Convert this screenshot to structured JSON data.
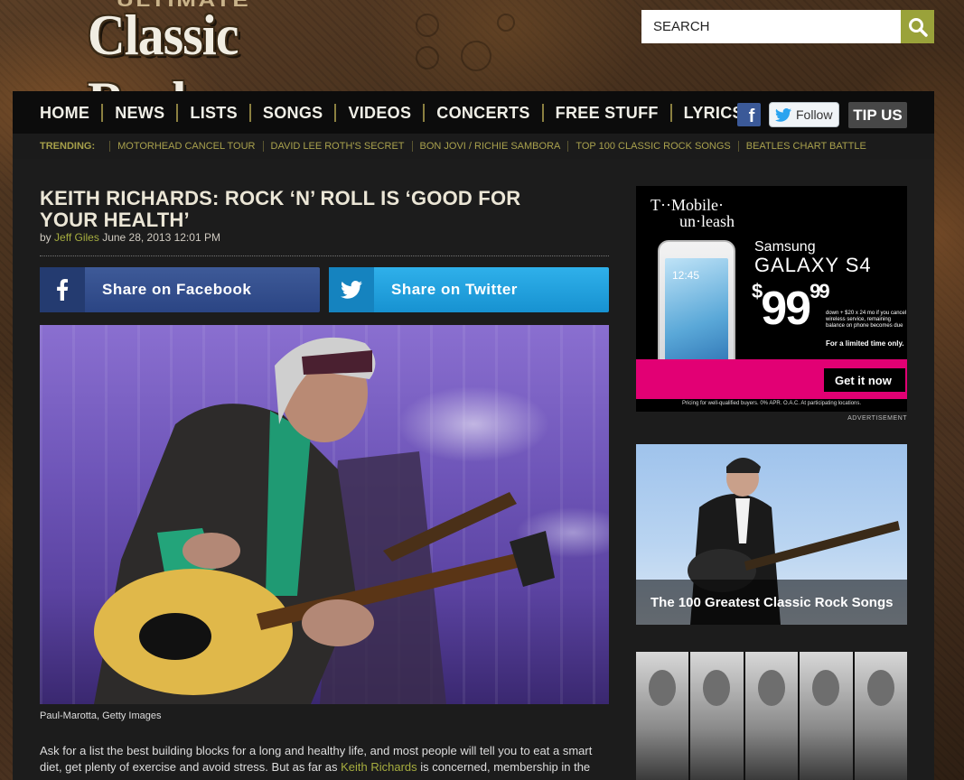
{
  "header": {
    "logo_top": "ULTIMATE",
    "logo_main": "Classic Rock",
    "search_placeholder": "SEARCH"
  },
  "nav": {
    "items": [
      "HOME",
      "NEWS",
      "LISTS",
      "SONGS",
      "VIDEOS",
      "CONCERTS",
      "FREE STUFF",
      "LYRICS"
    ],
    "follow_label": "Follow",
    "tip_label": "TIP US"
  },
  "trending": {
    "label": "TRENDING:",
    "items": [
      "MOTORHEAD CANCEL TOUR",
      "DAVID LEE ROTH'S SECRET",
      "BON JOVI / RICHIE SAMBORA",
      "TOP 100 CLASSIC ROCK SONGS",
      "BEATLES CHART BATTLE"
    ]
  },
  "article": {
    "title": "KEITH RICHARDS: ROCK ‘N’ ROLL IS ‘GOOD FOR YOUR HEALTH’",
    "by": "by",
    "author": "Jeff Giles",
    "date": "June 28, 2013 12:01 PM",
    "share_facebook": "Share on Facebook",
    "share_twitter": "Share on Twitter",
    "photo_credit": "Paul-Marotta, Getty Images",
    "para_1": "Ask for a list the best building blocks for a long and healthy life, and most people will tell you to eat a smart diet, get plenty of exercise and avoid stress. But as far as ",
    "para_link": "Keith Richards",
    "para_2": " is concerned, membership in the"
  },
  "ad": {
    "brand_line1": "T··Mobile·",
    "brand_line2": "un·leash",
    "screen_time": "12:45",
    "model_line1": "Samsung",
    "model_line2": "GALAXY S4",
    "price_dollar": "$",
    "price_main": "99",
    "price_cents": "99",
    "fine_print": "down + $20 x 24 mo if you cancel wireless service, remaining balance on phone becomes due",
    "limited": "For a limited time only.",
    "cta": "Get it now",
    "disclaimer": "Pricing for well-qualified buyers. 0% APR. O.A.C. At participating locations.",
    "label": "ADVERTISEMENT"
  },
  "promo": {
    "title": "The 100 Greatest Classic Rock Songs"
  },
  "colors": {
    "accent": "#9aa23a",
    "link": "#a6ad3f",
    "tmobile": "#e20074",
    "facebook": "#3b5998",
    "twitter": "#1da1e0"
  }
}
